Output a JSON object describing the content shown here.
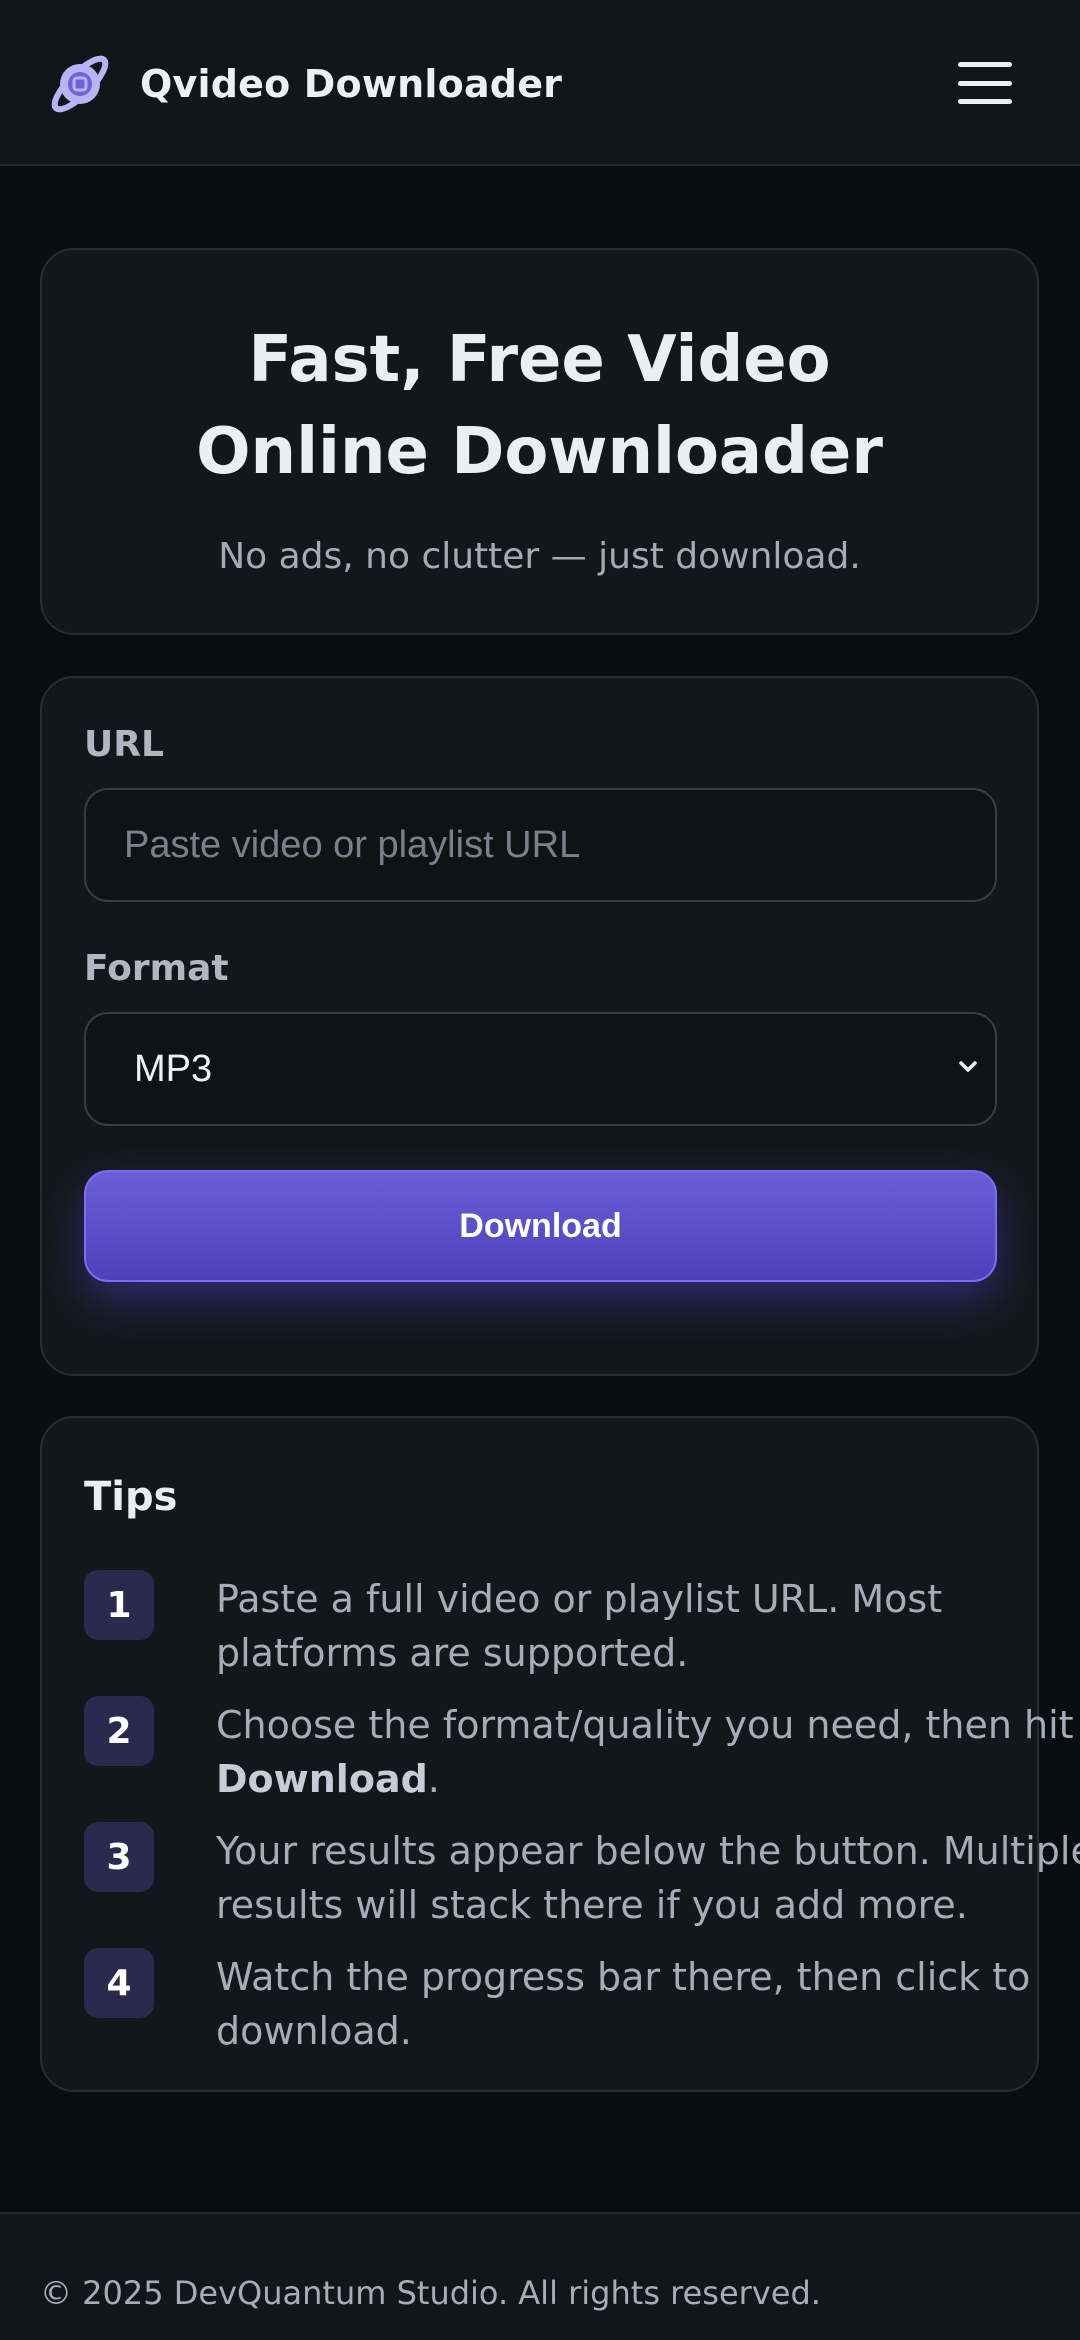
{
  "header": {
    "brand": "Qvideo Downloader",
    "logo_icon": "planet-logo-icon",
    "menu_icon": "hamburger-menu-icon"
  },
  "hero": {
    "title": "Fast, Free Video Online Downloader",
    "subtitle": "No ads, no clutter — just download."
  },
  "form": {
    "url_label": "URL",
    "url_value": "",
    "url_placeholder": "Paste video or playlist URL",
    "format_label": "Format",
    "format_selected": "MP3",
    "download_label": "Download"
  },
  "tips": {
    "title": "Tips",
    "items": [
      {
        "num": "1",
        "pre": "Paste a full video or playlist URL. Most platforms are supported.",
        "bold": "",
        "post": ""
      },
      {
        "num": "2",
        "pre": "Choose the format/quality you need, then hit ",
        "bold": "Download",
        "post": "."
      },
      {
        "num": "3",
        "pre": "Your results appear below the button. Multiple results will stack there if you add more.",
        "bold": "",
        "post": ""
      },
      {
        "num": "4",
        "pre": "Watch the progress bar there, then click to download.",
        "bold": "",
        "post": ""
      }
    ]
  },
  "footer": {
    "copyright": "© 2025 DevQuantum Studio. All rights reserved."
  },
  "colors": {
    "background": "#0b0c10",
    "card": "#15161b",
    "accent": "#5a4cc8",
    "tip_badge": "#2b2a4e"
  }
}
